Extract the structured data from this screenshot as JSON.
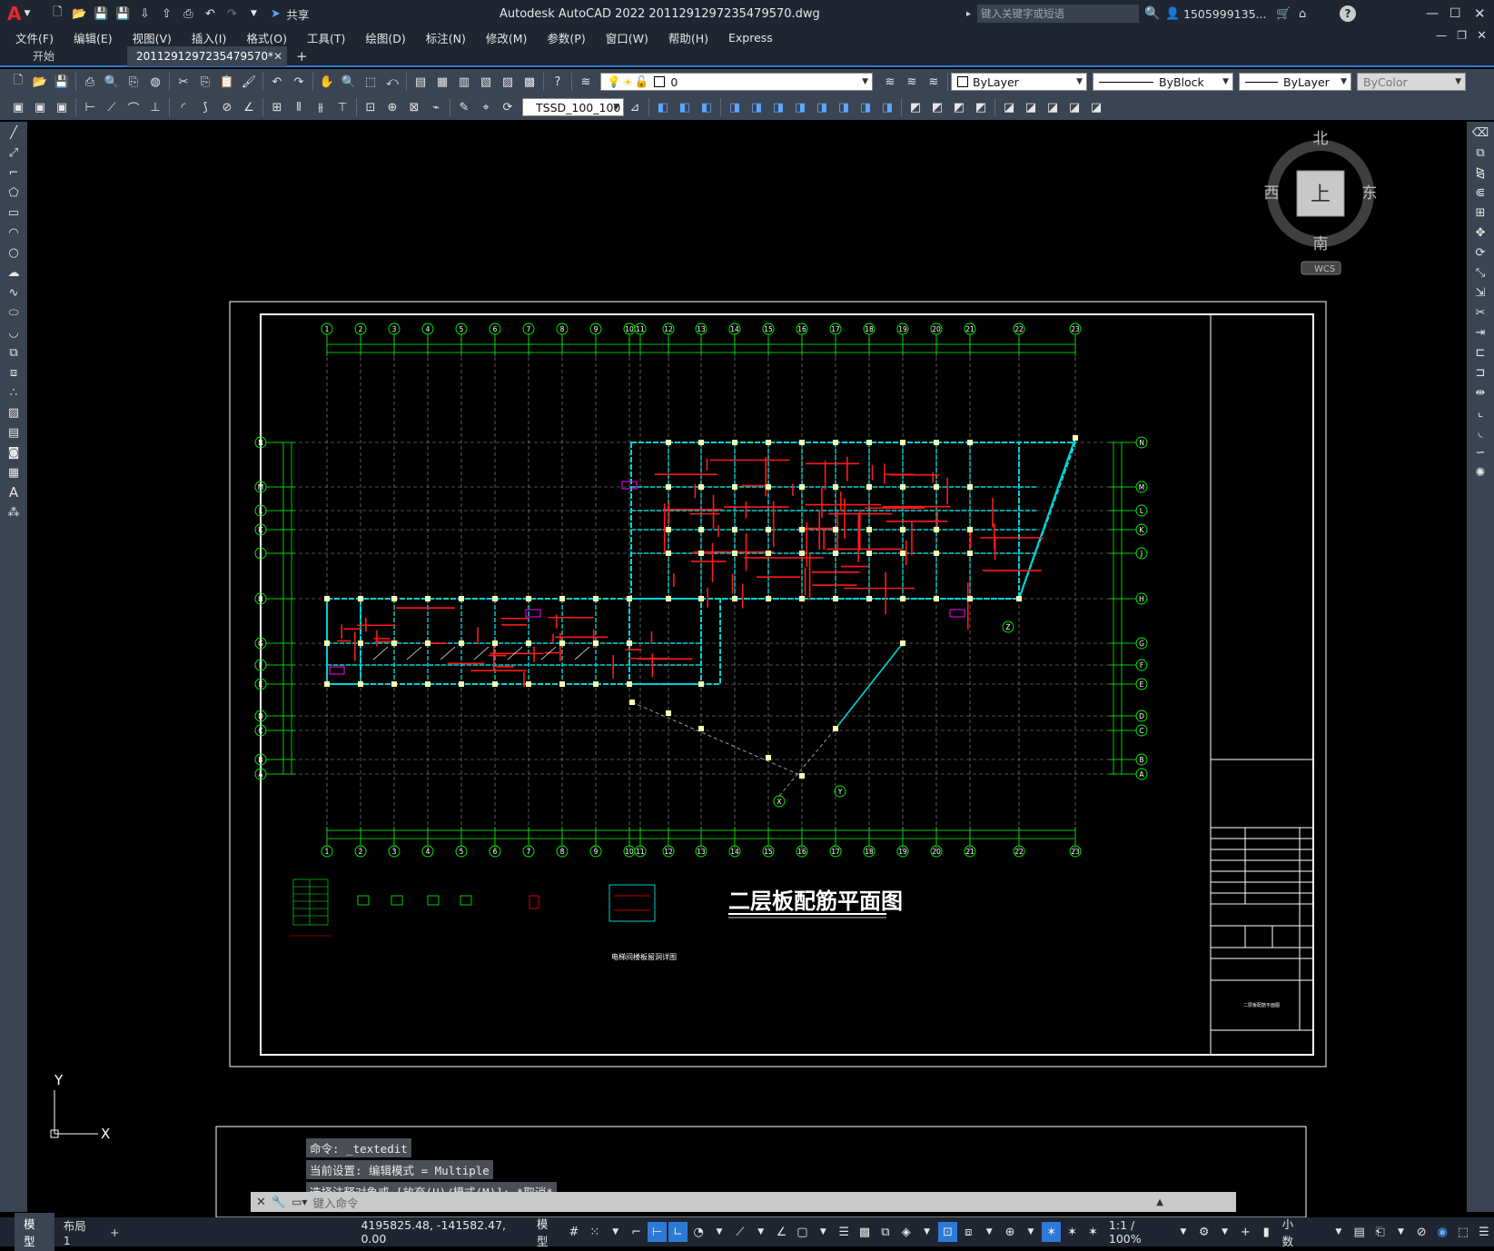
{
  "titlebar": {
    "app_logo": "A",
    "share_label": "共享",
    "title": "Autodesk AutoCAD 2022    2011291297235479570.dwg",
    "search_placeholder": "键入关键字或短语",
    "user": "1505999135...",
    "help": "?"
  },
  "menu": [
    "文件(F)",
    "编辑(E)",
    "视图(V)",
    "插入(I)",
    "格式(O)",
    "工具(T)",
    "绘图(D)",
    "标注(N)",
    "修改(M)",
    "参数(P)",
    "窗口(W)",
    "帮助(H)",
    "Express"
  ],
  "tabs": {
    "start": "开始",
    "active": "2011291297235479570*",
    "close": "✕",
    "add": "+"
  },
  "toolbar": {
    "layer_value": "0",
    "color_value": "ByLayer",
    "linetype_value": "ByBlock",
    "lineweight_value": "ByLayer",
    "plotstyle_value": "ByColor",
    "dimstyle_value": "TSSD_100_100"
  },
  "viewcube": {
    "north": "北",
    "south": "南",
    "east": "东",
    "west": "西",
    "top": "上",
    "wcs": "WCS"
  },
  "drawing": {
    "title": "二层板配筋平面图",
    "column_numbers": [
      "1",
      "2",
      "3",
      "4",
      "5",
      "6",
      "7",
      "8",
      "9",
      "10",
      "11",
      "12",
      "13",
      "14",
      "15",
      "16",
      "17",
      "18",
      "19",
      "20",
      "21",
      "22",
      "23"
    ],
    "row_letters": [
      "N",
      "M",
      "L",
      "K",
      "J",
      "H",
      "G",
      "F",
      "E",
      "D",
      "C",
      "B",
      "A"
    ],
    "aux_labels": [
      "X",
      "Y",
      "Z"
    ],
    "detail_caption": "电梯间楼板留洞详图",
    "title_block_name": "二层板配筋平面图"
  },
  "ucs": {
    "x": "X",
    "y": "Y"
  },
  "command": {
    "history": [
      "命令: _textedit",
      "当前设置: 编辑模式 = Multiple",
      "选择注释对象或 [放弃(U)/模式(M)]: *取消*"
    ],
    "placeholder": "键入命令"
  },
  "status": {
    "model_tab": "模型",
    "layout_tab": "布局1",
    "add_tab": "+",
    "coords": "4195825.48, -141582.47, 0.00",
    "space": "模型",
    "scale": "1:1 / 100%",
    "units": "小数"
  }
}
